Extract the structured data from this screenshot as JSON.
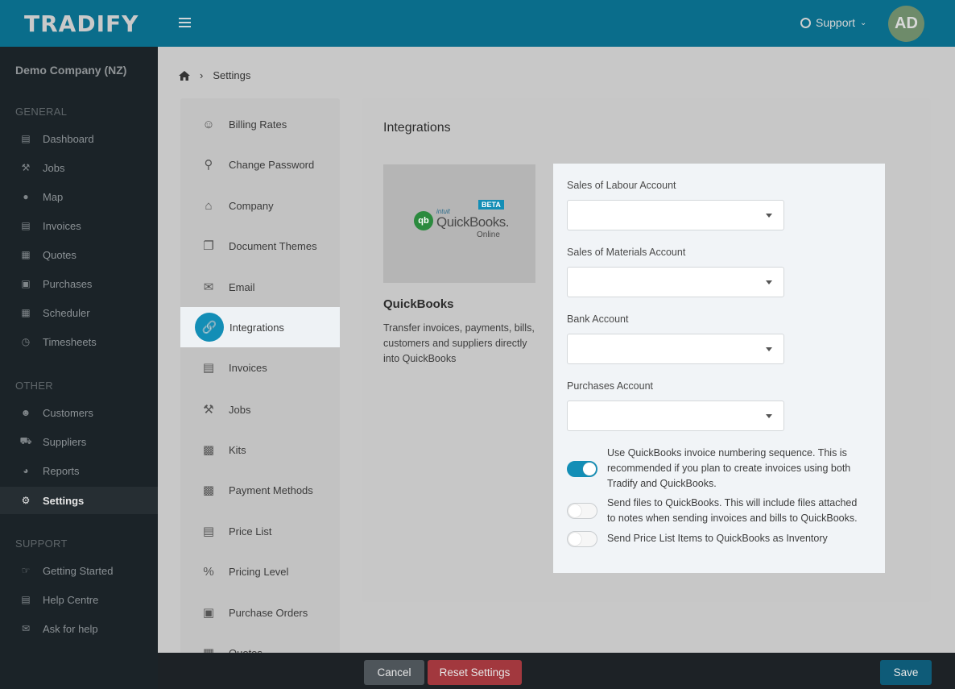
{
  "header": {
    "logo": "TRADIFY",
    "support_label": "Support",
    "avatar_initials": "AD"
  },
  "sidebar": {
    "company": "Demo Company (NZ)",
    "sections": [
      {
        "title": "GENERAL",
        "items": [
          {
            "label": "Dashboard",
            "icon": "dashboard-icon"
          },
          {
            "label": "Jobs",
            "icon": "hammer-icon"
          },
          {
            "label": "Map",
            "icon": "map-pin-icon"
          },
          {
            "label": "Invoices",
            "icon": "invoice-icon"
          },
          {
            "label": "Quotes",
            "icon": "calculator-icon"
          },
          {
            "label": "Purchases",
            "icon": "cart-icon"
          },
          {
            "label": "Scheduler",
            "icon": "calendar-icon"
          },
          {
            "label": "Timesheets",
            "icon": "clock-icon"
          }
        ]
      },
      {
        "title": "OTHER",
        "items": [
          {
            "label": "Customers",
            "icon": "users-icon"
          },
          {
            "label": "Suppliers",
            "icon": "truck-icon"
          },
          {
            "label": "Reports",
            "icon": "pie-chart-icon"
          },
          {
            "label": "Settings",
            "icon": "gear-icon",
            "active": true
          }
        ]
      },
      {
        "title": "SUPPORT",
        "items": [
          {
            "label": "Getting Started",
            "icon": "thumbs-up-icon"
          },
          {
            "label": "Help Centre",
            "icon": "book-icon"
          },
          {
            "label": "Ask for help",
            "icon": "chat-icon"
          }
        ]
      }
    ]
  },
  "breadcrumb": {
    "current": "Settings"
  },
  "settings_menu": {
    "items": [
      {
        "label": "Billing Rates",
        "icon": "person-icon"
      },
      {
        "label": "Change Password",
        "icon": "unlock-icon"
      },
      {
        "label": "Company",
        "icon": "home-icon"
      },
      {
        "label": "Document Themes",
        "icon": "copy-icon"
      },
      {
        "label": "Email",
        "icon": "envelope-icon"
      },
      {
        "label": "Integrations",
        "icon": "link-icon",
        "active": true
      },
      {
        "label": "Invoices",
        "icon": "file-icon"
      },
      {
        "label": "Jobs",
        "icon": "hammer-icon"
      },
      {
        "label": "Kits",
        "icon": "cubes-icon"
      },
      {
        "label": "Payment Methods",
        "icon": "money-icon"
      },
      {
        "label": "Price List",
        "icon": "book-icon"
      },
      {
        "label": "Pricing Level",
        "icon": "percent-icon"
      },
      {
        "label": "Purchase Orders",
        "icon": "cart-icon"
      },
      {
        "label": "Quotes",
        "icon": "calculator-icon"
      }
    ]
  },
  "integrations": {
    "title": "Integrations",
    "quickbooks": {
      "logo_intuit": "intuit",
      "logo_name": "QuickBooks.",
      "logo_online": "Online",
      "logo_badge": "BETA",
      "title": "QuickBooks",
      "description": "Transfer invoices, payments, bills, customers and suppliers directly into QuickBooks"
    },
    "fields": [
      {
        "label": "Sales of Labour Account",
        "value": ""
      },
      {
        "label": "Sales of Materials Account",
        "value": ""
      },
      {
        "label": "Bank Account",
        "value": ""
      },
      {
        "label": "Purchases Account",
        "value": ""
      }
    ],
    "toggles": [
      {
        "label": "Use QuickBooks invoice numbering sequence. This is recommended if you plan to create invoices using both Tradify and QuickBooks.",
        "on": true
      },
      {
        "label": "Send files to QuickBooks. This will include files attached to notes when sending invoices and bills to QuickBooks.",
        "on": false
      },
      {
        "label": "Send Price List Items to QuickBooks as Inventory",
        "on": false
      }
    ]
  },
  "footer": {
    "cancel_label": "Cancel",
    "reset_label": "Reset Settings",
    "save_label": "Save"
  },
  "colors": {
    "header_bg": "#0a6d8b",
    "accent": "#138eb6",
    "danger": "#a2383e",
    "sidebar_bg": "#1b2328"
  }
}
